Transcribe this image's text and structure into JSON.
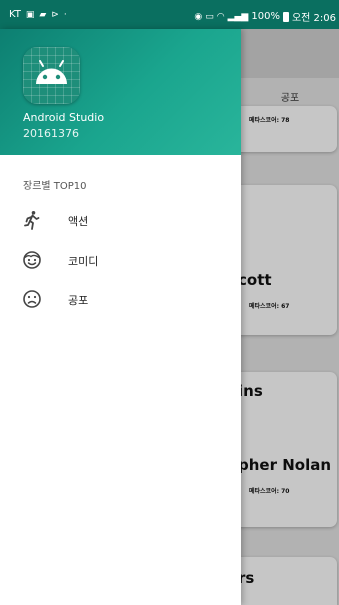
{
  "status_bar": {
    "carrier": "KT",
    "right_text": "100%",
    "time": "오전 2:06"
  },
  "background": {
    "toolbar_title": "공포",
    "cards": [
      {
        "meta": "메타스코어: 78"
      },
      {
        "name": "cott",
        "meta": "메타스코어: 67"
      },
      {
        "name": "ins"
      },
      {
        "name": "pher Nolan",
        "meta": "메타스코어: 70"
      },
      {
        "name": "rs"
      }
    ]
  },
  "drawer": {
    "header": {
      "app_name": "Android Studio",
      "user_id": "20161376"
    },
    "section_title": "장르별 TOP10",
    "items": [
      {
        "label": "액션",
        "icon": "running-icon"
      },
      {
        "label": "코미디",
        "icon": "smile-icon"
      },
      {
        "label": "공포",
        "icon": "sad-face-icon"
      }
    ]
  },
  "colors": {
    "header_start": "#0d7f71",
    "header_end": "#29b59b",
    "status_bar": "#0a6f60"
  }
}
